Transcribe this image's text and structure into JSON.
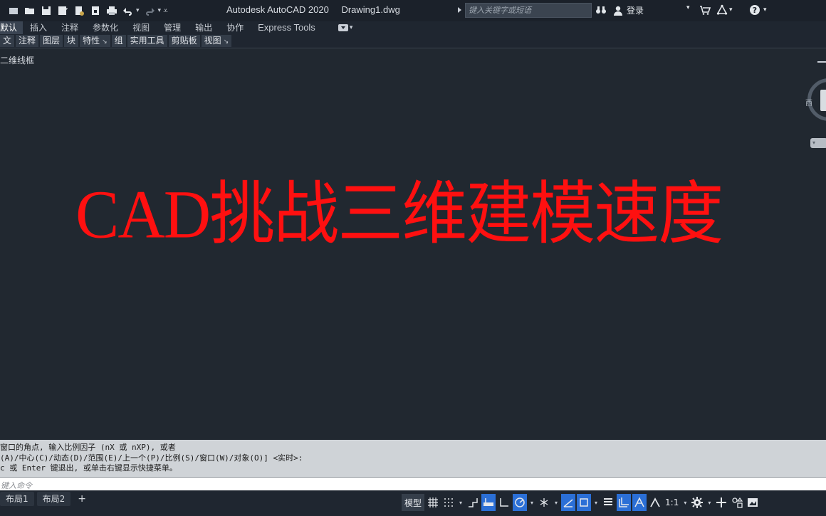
{
  "app": {
    "product": "Autodesk AutoCAD 2020",
    "document": "Drawing1.dwg"
  },
  "search": {
    "placeholder": "键入关键字或短语"
  },
  "account": {
    "sign_in_label": "登录"
  },
  "ribbon_tabs": [
    {
      "label": "默认",
      "active": true
    },
    {
      "label": "插入"
    },
    {
      "label": "注释"
    },
    {
      "label": "参数化"
    },
    {
      "label": "视图"
    },
    {
      "label": "管理"
    },
    {
      "label": "输出"
    },
    {
      "label": "协作"
    },
    {
      "label": "Express Tools"
    }
  ],
  "ribbon_panels": [
    {
      "label": "文"
    },
    {
      "label": "注释"
    },
    {
      "label": "图层"
    },
    {
      "label": "块"
    },
    {
      "label": "特性",
      "expand": "↘"
    },
    {
      "label": "组"
    },
    {
      "label": "实用工具"
    },
    {
      "label": "剪贴板"
    },
    {
      "label": "视图",
      "expand": "↘"
    }
  ],
  "viewport": {
    "label": "二维线框",
    "overlay_title": "CAD挑战三维建模速度",
    "viewcube_west": "西"
  },
  "command": {
    "history": [
      "窗口的角点, 输入比例因子 (nX 或 nXP), 或者",
      "(A)/中心(C)/动态(D)/范围(E)/上一个(P)/比例(S)/窗口(W)/对象(O)] <实时>:",
      "c 或 Enter 键退出, 或单击右键显示快捷菜单。"
    ],
    "input_placeholder": "键入命令"
  },
  "layout_tabs": [
    {
      "label": "布局1"
    },
    {
      "label": "布局2"
    }
  ],
  "layout_add": "+",
  "status": {
    "model_label": "模型",
    "scale_label": "1:1"
  },
  "colors": {
    "title_text": "#ff1010",
    "toggle_on": "#2b6fd6"
  }
}
